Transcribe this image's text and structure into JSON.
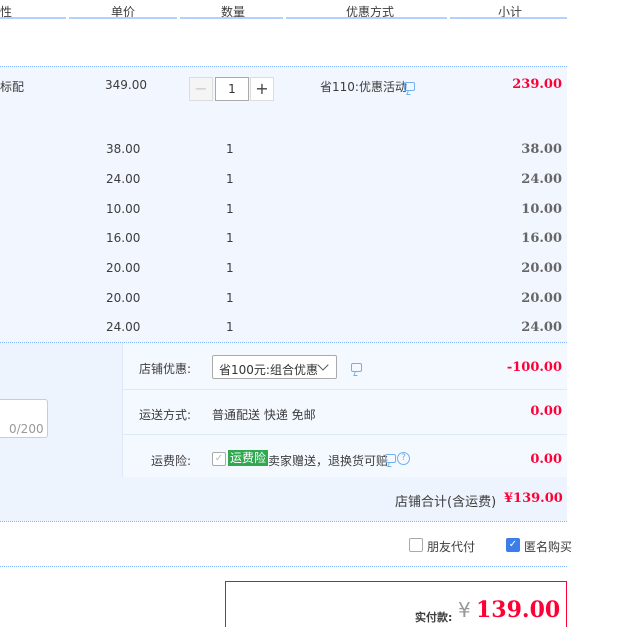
{
  "header": {
    "col_attr": "性",
    "col_price": "单价",
    "col_qty": "数量",
    "col_discount": "优惠方式",
    "col_subtotal": "小计"
  },
  "main_item": {
    "spec_fragment": "标配",
    "price": "349.00",
    "qty": "1",
    "qty_minus": "−",
    "qty_plus": "+",
    "discount": "省110:优惠活动",
    "subtotal": "239.00"
  },
  "gift_items": [
    {
      "price": "38.00",
      "qty": "1",
      "subtotal": "38.00"
    },
    {
      "price": "24.00",
      "qty": "1",
      "subtotal": "24.00"
    },
    {
      "price": "10.00",
      "qty": "1",
      "subtotal": "10.00"
    },
    {
      "price": "16.00",
      "qty": "1",
      "subtotal": "16.00"
    },
    {
      "price": "20.00",
      "qty": "1",
      "subtotal": "20.00"
    },
    {
      "price": "20.00",
      "qty": "1",
      "subtotal": "20.00"
    },
    {
      "price": "24.00",
      "qty": "1",
      "subtotal": "24.00"
    }
  ],
  "shop": {
    "coupon_label": "店铺优惠:",
    "coupon_value": "省100元:组合优惠",
    "coupon_amount": "-100.00",
    "shipping_label": "运送方式:",
    "shipping_value": "普通配送 快递 免邮",
    "shipping_amount": "0.00",
    "insurance_label": "运费险:",
    "insurance_badge": "运费险",
    "insurance_text": "卖家赠送，退换货可赔",
    "insurance_amount": "0.00",
    "message_counter": "0/200",
    "total_label": "店铺合计(含运费)",
    "total_value": "¥139.00"
  },
  "options": {
    "friend_pay": "朋友代付",
    "anonymous": "匿名购买"
  },
  "payment": {
    "label": "实付款:",
    "currency": "¥",
    "amount": "139.00"
  },
  "colors": {
    "accent_red": "#ff0036",
    "accent_blue": "#3b7de9",
    "panel_bg": "#f2f7ff",
    "insurance_green": "#2fa84f"
  }
}
